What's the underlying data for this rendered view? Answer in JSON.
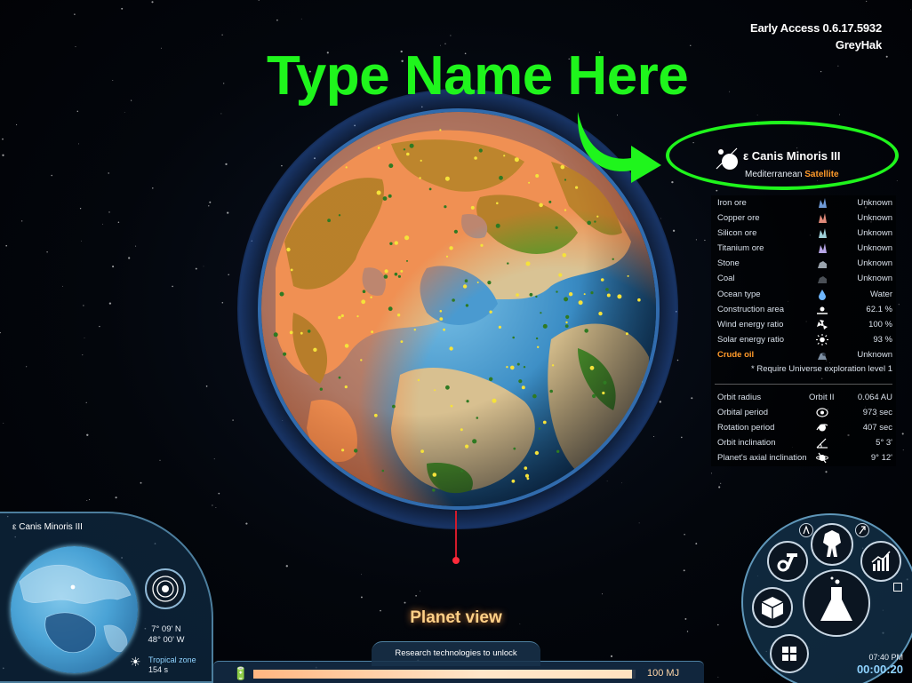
{
  "version": {
    "line1": "Early Access 0.6.17.5932",
    "line2": "GreyHak"
  },
  "annotation": {
    "text": "Type Name Here",
    "color": "#1ff51c"
  },
  "planet": {
    "name": "ε Canis Minoris III",
    "type_prefix": "Mediterranean",
    "type_suffix": "Satellite"
  },
  "resources": [
    {
      "label": "Iron ore",
      "icon": "iron-ore-icon",
      "value": "Unknown"
    },
    {
      "label": "Copper ore",
      "icon": "copper-ore-icon",
      "value": "Unknown"
    },
    {
      "label": "Silicon ore",
      "icon": "silicon-ore-icon",
      "value": "Unknown"
    },
    {
      "label": "Titanium ore",
      "icon": "titanium-ore-icon",
      "value": "Unknown"
    },
    {
      "label": "Stone",
      "icon": "stone-icon",
      "value": "Unknown"
    },
    {
      "label": "Coal",
      "icon": "coal-icon",
      "value": "Unknown"
    },
    {
      "label": "Ocean type",
      "icon": "water-drop-icon",
      "value": "Water"
    },
    {
      "label": "Construction area",
      "icon": "construction-area-icon",
      "value": "62.1 %"
    },
    {
      "label": "Wind energy ratio",
      "icon": "wind-icon",
      "value": "100 %"
    },
    {
      "label": "Solar energy ratio",
      "icon": "sun-icon",
      "value": "93 %"
    },
    {
      "label": "Crude oil",
      "icon": "crude-oil-icon",
      "value": "Unknown"
    }
  ],
  "note": "* Require Universe exploration level 1",
  "orbit": [
    {
      "label": "Orbit radius",
      "mid": "Orbit II",
      "icon": "",
      "value": "0.064 AU"
    },
    {
      "label": "Orbital period",
      "mid": "",
      "icon": "orbit-icon",
      "value": "973 sec"
    },
    {
      "label": "Rotation period",
      "mid": "",
      "icon": "rotation-icon",
      "value": "407 sec"
    },
    {
      "label": "Orbit inclination",
      "mid": "",
      "icon": "inclination-icon",
      "value": "5° 3'"
    },
    {
      "label": "Planet's axial inclination",
      "mid": "",
      "icon": "axial-tilt-icon",
      "value": "9° 12'"
    }
  ],
  "minimap": {
    "title": "ε  Canis Minoris III",
    "lat": "7° 09'  N",
    "lon": "48° 00'  W",
    "zone": "Tropical zone",
    "zone_time": "154 s"
  },
  "view_title": "Planet view",
  "research_prompt": "Research technologies to unlock",
  "energy": {
    "fill": 0.99,
    "label": "100 MJ"
  },
  "clock": {
    "time": "07:40 PM",
    "elapsed": "00:00:20"
  }
}
